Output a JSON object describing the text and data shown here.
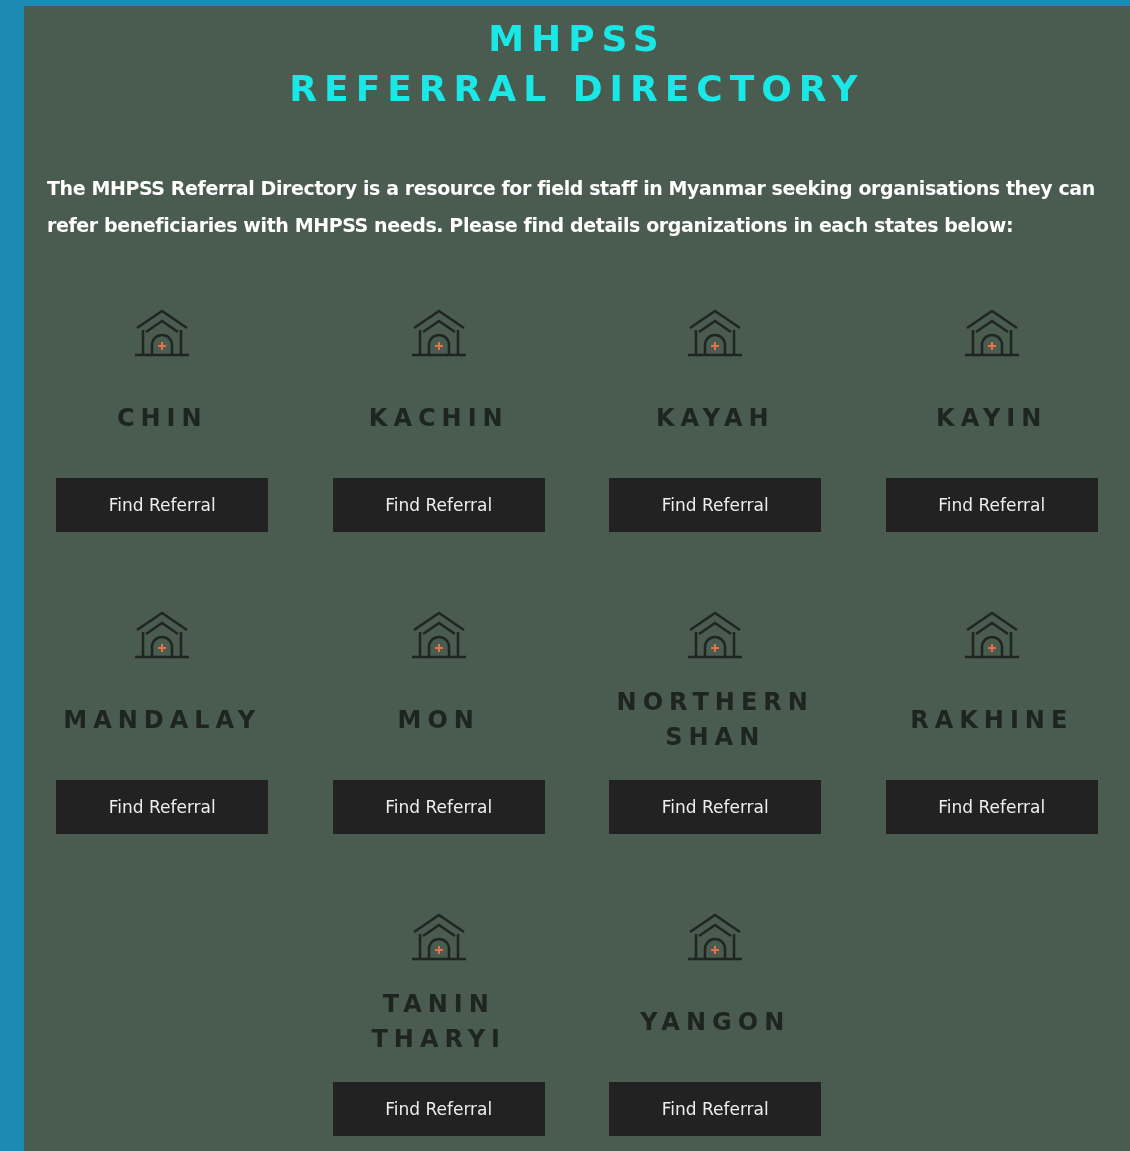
{
  "title_lines": [
    "MHPSS",
    "REFERRAL DIRECTORY"
  ],
  "intro": "The MHPSS Referral Directory is a resource for field staff in Myanmar seeking organisations they can refer beneficiaries with MHPSS needs. Please find details organizations in each states below:",
  "states": [
    {
      "name": "CHIN",
      "button": "Find Referral"
    },
    {
      "name": "KACHIN",
      "button": "Find Referral"
    },
    {
      "name": "KAYAH",
      "button": "Find Referral"
    },
    {
      "name": "KAYIN",
      "button": "Find Referral"
    },
    {
      "name": "MANDALAY",
      "button": "Find Referral"
    },
    {
      "name": "MON",
      "button": "Find Referral"
    },
    {
      "name": "NORTHERN SHAN",
      "button": "Find Referral"
    },
    {
      "name": "RAKHINE",
      "button": "Find Referral"
    },
    {
      "name": "TANIN THARYI",
      "button": "Find Referral"
    },
    {
      "name": "YANGON",
      "button": "Find Referral"
    }
  ]
}
